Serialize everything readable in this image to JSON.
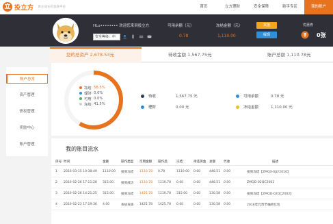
{
  "header": {
    "logo_mark": "立",
    "logo_name": "投立方",
    "logo_slogan": "真正成长的金融平台",
    "nav": [
      "首页",
      "立方理财",
      "安全保障",
      "新手专区",
      "我的账户"
    ]
  },
  "profile": {
    "username": "HLu•••••••• 欢迎您来到投立方",
    "security_level": "安全等级：中",
    "stats": [
      {
        "label": "可用余额（元）",
        "value": "0.78"
      },
      {
        "label": "冻结金额（元）",
        "value": "1,110.00"
      }
    ],
    "charge_label": "充值",
    "withdraw_label": "提现",
    "coupon_label": "优惠券",
    "coupon_value": "0张"
  },
  "tabs": [
    {
      "label": "您的总资产 2,678.53元"
    },
    {
      "label": "待收金额 1,567.75元"
    },
    {
      "label": "账户总额 1,110.78元"
    }
  ],
  "sidebar": {
    "items": [
      "账户总览",
      "资产管理",
      "债权管理",
      "奖励中心",
      "账户管理"
    ]
  },
  "assets": {
    "legend": [
      {
        "name": "冻结",
        "value": "58.5%",
        "color": "#e8731f"
      },
      {
        "name": "理财",
        "value": "0.0%",
        "color": "#2f8fd8"
      },
      {
        "name": "可用",
        "value": "0.0%",
        "color": "#4caf50"
      },
      {
        "name": "冻结",
        "value": "41.5%",
        "color": "#e8e8e8"
      }
    ],
    "donut_shares": [
      0.585,
      0.0,
      0.0,
      0.415
    ],
    "items": [
      {
        "label": "待收",
        "value": "1,567.75 元",
        "color": "#2f3a55"
      },
      {
        "label": "理财",
        "value": "0.00 元",
        "color": "#2f8fd8"
      },
      {
        "label": "可用余额",
        "value": "0.78 元",
        "color": "#2f8fd8"
      },
      {
        "label": "冻结金额",
        "value": "1,110.00 元",
        "color": "#e8c21f"
      }
    ]
  },
  "ledger": {
    "title": "我的账目流水",
    "columns": [
      "序号",
      "时间",
      "金额",
      "操作类型",
      "可用金额",
      "操作后",
      "冻结",
      "待还资金",
      "总额",
      "代收",
      "描述"
    ],
    "rows": [
      [
        "1",
        "2016-03-15 10:38:49",
        "1110.00",
        "投资冻结",
        "1110.78",
        "0.78",
        "1110.00",
        "0.00",
        "448.51",
        "0.00",
        "投资冻结【ZMQX-0JLY2016】"
      ],
      [
        "2",
        "2016-02-26 17:11:28",
        "315.00",
        "投资成功",
        "1110.78",
        "1110.78",
        "0.00",
        "0.00",
        "448.51",
        "0.00",
        "ZMQD-02QC2002"
      ],
      [
        "3",
        "2016-02-26 14:21:25",
        "315.00",
        "投资冻结",
        "1425.78",
        "1110.78",
        "315.00",
        "0.00",
        "130.58",
        "0.00",
        "投资冻结【ZMQD-02QC2002】"
      ],
      [
        "4",
        "2016-02-23 17:19:36",
        "4.00",
        "系统充值",
        "1425.78",
        "1425.78",
        "0.00",
        "0.00",
        "130.58",
        "0.00",
        "2016年元宵节抽奖红包"
      ]
    ]
  }
}
